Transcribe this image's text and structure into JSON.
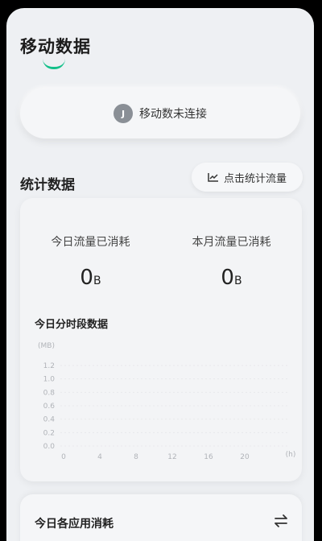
{
  "page": {
    "title": "移动数据"
  },
  "connection": {
    "icon": "sim-icon",
    "icon_glyph": "J",
    "status_text": "移动数未连接"
  },
  "stats_section": {
    "title": "统计数据",
    "button_label": "点击统计流量",
    "button_icon": "line-chart-icon"
  },
  "usage": {
    "today_label": "今日流量已消耗",
    "today_value": "0",
    "today_unit": "B",
    "month_label": "本月流量已消耗",
    "month_value": "0",
    "month_unit": "B"
  },
  "chart_data": {
    "type": "bar",
    "title": "今日分时段数据",
    "y_unit": "(MB)",
    "x_unit": "(h)",
    "ylim": [
      0,
      1.2
    ],
    "y_ticks": [
      "1.2",
      "1.0",
      "0.8",
      "0.6",
      "0.4",
      "0.2",
      "0.0"
    ],
    "x_ticks": [
      "0",
      "4",
      "8",
      "12",
      "16",
      "20"
    ],
    "values": [],
    "grid": true,
    "accent": "#14c08a"
  },
  "app_usage": {
    "title": "今日各应用消耗",
    "swap_icon": "swap-icon"
  }
}
